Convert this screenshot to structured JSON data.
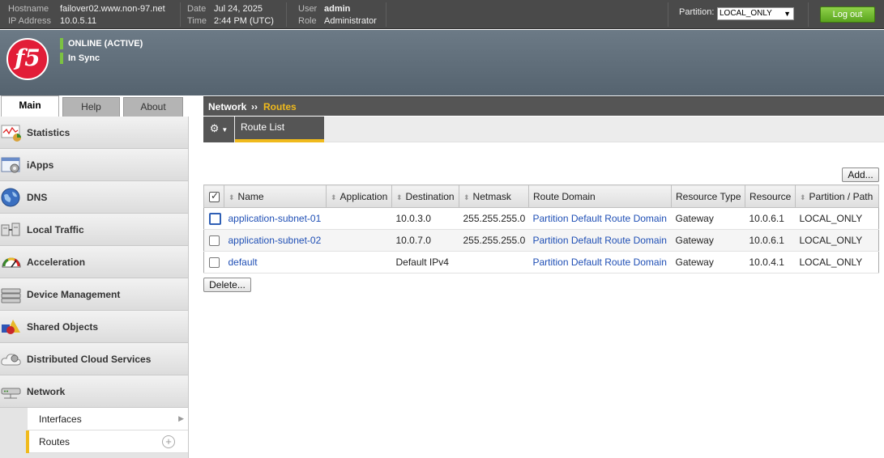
{
  "topbar": {
    "hostname_label": "Hostname",
    "hostname": "failover02.www.non-97.net",
    "ip_label": "IP Address",
    "ip": "10.0.5.11",
    "date_label": "Date",
    "date": "Jul 24, 2025",
    "time_label": "Time",
    "time": "2:44 PM (UTC)",
    "user_label": "User",
    "user": "admin",
    "role_label": "Role",
    "role": "Administrator",
    "partition_label": "Partition:",
    "partition_value": "LOCAL_ONLY",
    "logout_label": "Log out",
    "logout_color": "#5aa41e"
  },
  "banner": {
    "logo_text": "f5",
    "status_online": "ONLINE (ACTIVE)",
    "status_sync": "In Sync",
    "status_color": "#7cc242"
  },
  "tabs": {
    "main": "Main",
    "help": "Help",
    "about": "About"
  },
  "sidebar": {
    "items": [
      {
        "label": "Statistics",
        "icon": "statistics-icon"
      },
      {
        "label": "iApps",
        "icon": "iapps-icon"
      },
      {
        "label": "DNS",
        "icon": "dns-globe-icon"
      },
      {
        "label": "Local Traffic",
        "icon": "local-traffic-icon"
      },
      {
        "label": "Acceleration",
        "icon": "acceleration-gauge-icon"
      },
      {
        "label": "Device Management",
        "icon": "device-management-icon"
      },
      {
        "label": "Shared Objects",
        "icon": "shared-objects-icon"
      },
      {
        "label": "Distributed Cloud Services",
        "icon": "cloud-services-icon"
      },
      {
        "label": "Network",
        "icon": "network-icon"
      }
    ],
    "sub_items": [
      {
        "label": "Interfaces"
      },
      {
        "label": "Routes"
      }
    ]
  },
  "breadcrumb": {
    "section": "Network",
    "separator": "››",
    "page": "Routes",
    "accent": "#f0ba1c"
  },
  "subtabs": {
    "route_list": "Route List"
  },
  "actions": {
    "add": "Add...",
    "delete": "Delete..."
  },
  "table": {
    "headers": [
      "Name",
      "Application",
      "Destination",
      "Netmask",
      "Route Domain",
      "Resource Type",
      "Resource",
      "Partition / Path"
    ],
    "rows": [
      {
        "name": "application-subnet-01",
        "application": "",
        "destination": "10.0.3.0",
        "netmask": "255.255.255.0",
        "route_domain": "Partition Default Route Domain",
        "resource_type": "Gateway",
        "resource": "10.0.6.1",
        "partition": "LOCAL_ONLY"
      },
      {
        "name": "application-subnet-02",
        "application": "",
        "destination": "10.0.7.0",
        "netmask": "255.255.255.0",
        "route_domain": "Partition Default Route Domain",
        "resource_type": "Gateway",
        "resource": "10.0.6.1",
        "partition": "LOCAL_ONLY"
      },
      {
        "name": "default",
        "application": "",
        "destination": "Default IPv4",
        "netmask": "",
        "route_domain": "Partition Default Route Domain",
        "resource_type": "Gateway",
        "resource": "10.0.4.1",
        "partition": "LOCAL_ONLY"
      }
    ]
  }
}
